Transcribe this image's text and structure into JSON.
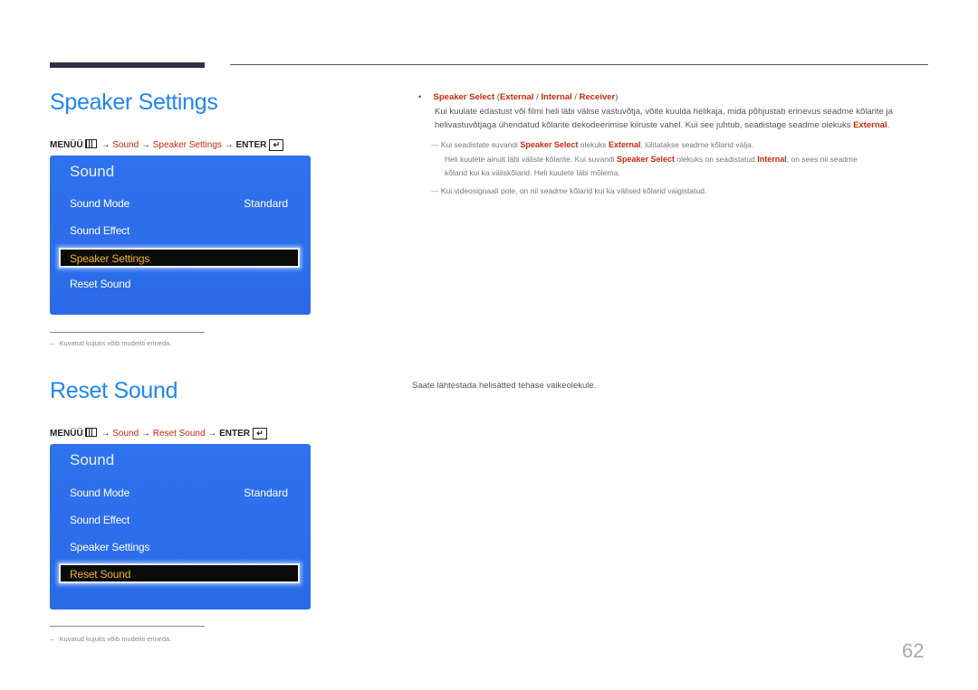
{
  "section1": {
    "title": "Speaker Settings",
    "breadcrumb": {
      "menu": "MENÜÜ",
      "arrow": "→",
      "step1": "Sound",
      "step2": "Speaker Settings",
      "enter": "ENTER"
    },
    "osd": {
      "title": "Sound",
      "items": [
        {
          "label": "Sound Mode",
          "value": "Standard"
        },
        {
          "label": "Sound Effect",
          "value": ""
        },
        {
          "label": "Speaker Settings",
          "value": ""
        },
        {
          "label": "Reset Sound",
          "value": ""
        }
      ],
      "selected_index": 2
    },
    "footnote": "Kuvatud kujutis võib mudeliti erineda.",
    "details": {
      "bullet": "•",
      "option_name": "Speaker Select",
      "options": [
        "External",
        "Internal",
        "Receiver"
      ],
      "para_line1": "Kui kuulate edastust või filmi heli läbi välise vastuvõtja, võite kuulda helikaja, mida põhjustab erinevus seadme kõlarite ja",
      "para_line2_pre": "helivastuvõtjaga ühendatud kõlarite dekodeerimise kiiruste vahel. Kui see juhtub, seadistage seadme olekuks",
      "para_line2_val": "External",
      "note1_a": "Kui seadistate suvandi",
      "note1_b": "Speaker Select",
      "note1_c": "olekuks",
      "note1_d": "External",
      "note1_e": ", lülitatakse seadme kõlarid välja.",
      "note1_line2_a": "Heli kuulete ainult läbi väliste kõlarite. Kui suvandi",
      "note1_line2_b": "Speaker Select",
      "note1_line2_c": "olekuks on seadistatud",
      "note1_line2_d": "Internal",
      "note1_line2_e": ", on sees nii seadme",
      "note1_line3": "kõlarid kui ka väliskõlarid. Heli kuulete läbi mõlema.",
      "note2": "Kui videosignaali pole, on nii seadme kõlarid kui ka välised kõlarid vaigistatud."
    }
  },
  "section2": {
    "title": "Reset Sound",
    "breadcrumb": {
      "menu": "MENÜÜ",
      "arrow": "→",
      "step1": "Sound",
      "step2": "Reset Sound",
      "enter": "ENTER"
    },
    "osd": {
      "title": "Sound",
      "items": [
        {
          "label": "Sound Mode",
          "value": "Standard"
        },
        {
          "label": "Sound Effect",
          "value": ""
        },
        {
          "label": "Speaker Settings",
          "value": ""
        },
        {
          "label": "Reset Sound",
          "value": ""
        }
      ],
      "selected_index": 3
    },
    "footnote": "Kuvatud kujutis võib mudeliti erineda.",
    "description": "Saate lähtestada helisätted tehase vaikeolekule."
  },
  "page_number": "62",
  "colors": {
    "heading": "#1f86f1",
    "highlight": "#c8280d",
    "osd_bg": "#2f72ee",
    "selected_text": "#f0b52c"
  }
}
